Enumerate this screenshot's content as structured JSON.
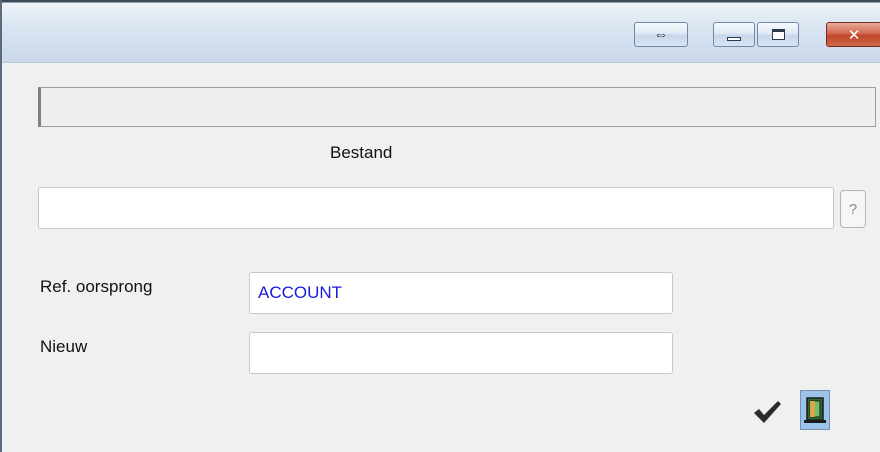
{
  "titlebar": {
    "resize_icon": "double-arrow-icon",
    "minimize_icon": "minimize-icon",
    "maximize_icon": "maximize-icon",
    "close_icon": "close-icon"
  },
  "form": {
    "section_title": "Bestand",
    "file_input": {
      "value": ""
    },
    "help_button_label": "?",
    "ref_origin": {
      "label": "Ref. oorsprong",
      "value": "ACCOUNT"
    },
    "new": {
      "label": "Nieuw",
      "value": ""
    }
  },
  "actions": {
    "confirm_icon": "checkmark-icon",
    "exit_icon": "exit-door-icon"
  },
  "colors": {
    "value_text": "#1a1adb",
    "title_gradient_top": "#eef3f9",
    "close_red": "#c2452a"
  }
}
